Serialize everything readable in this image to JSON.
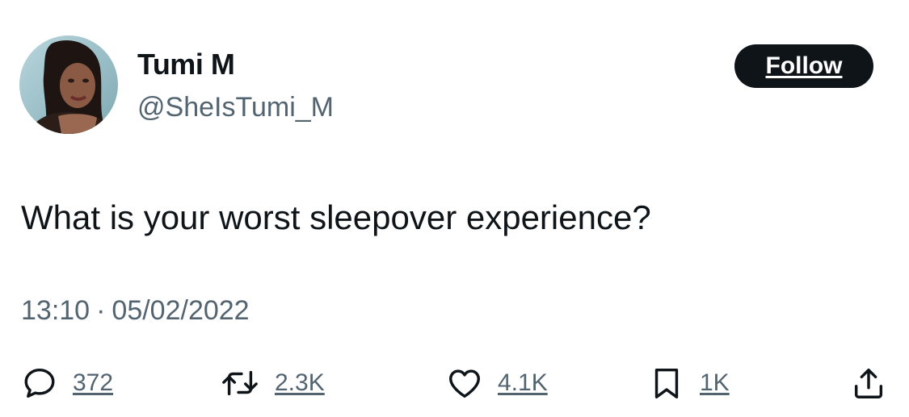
{
  "author": {
    "display_name": "Tumi M",
    "handle": "@SheIsTumi_M"
  },
  "follow_label": "Follow",
  "tweet": {
    "text": "What is your worst sleepover experience?",
    "time": "13:10",
    "separator": "·",
    "date": "05/02/2022"
  },
  "actions": {
    "replies": "372",
    "retweets": "2.3K",
    "likes": "4.1K",
    "bookmarks": "1K"
  },
  "icons": {
    "reply": "speech-bubble-icon",
    "retweet": "retweet-arrows-icon",
    "like": "heart-icon",
    "bookmark": "bookmark-icon",
    "share": "share-upload-icon"
  },
  "colors": {
    "text_primary": "#0f1419",
    "text_secondary": "#536471",
    "follow_bg": "#0f1419",
    "follow_text": "#ffffff",
    "background": "#ffffff"
  }
}
